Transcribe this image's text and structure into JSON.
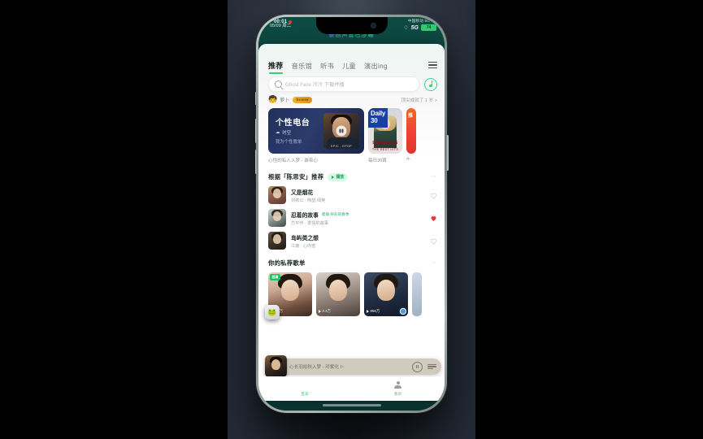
{
  "status_bar": {
    "time": "00:01",
    "date": "05/09 周二",
    "carrier": "中国移动 5G 4G",
    "network": "5G",
    "battery": "74",
    "wifi_icon": "wifi-icon",
    "record_dot": "recording-indicator",
    "notification_banner": "录制声音已涉唰"
  },
  "nav_tabs": [
    {
      "label": "推荐",
      "active": true
    },
    {
      "label": "音乐馆",
      "active": false
    },
    {
      "label": "听书",
      "active": false
    },
    {
      "label": "儿童",
      "active": false
    },
    {
      "label": "演出ing",
      "active": false
    }
  ],
  "header": {
    "menu_icon": "hamburger-menu-icon",
    "note_icon": "music-note-icon"
  },
  "search": {
    "icon": "search-icon",
    "placeholder": "Ghost Face 冷冷 下载并播"
  },
  "chip_row": {
    "emoji": "🧒",
    "text": "萝卜",
    "badge": "Scorer",
    "right_text": "顶尖成就了 1 岁 >"
  },
  "banners": [
    {
      "id": "personal-radio",
      "title": "个性电台",
      "subtitle_1": "时空",
      "subtitle_2": "我为个性歌单",
      "thumb_caption": "EPIC - EPOP",
      "play_icon": "pause-icon",
      "caption": "心性的私人入梦 - 谁带心"
    },
    {
      "id": "daily-30",
      "title_line1": "Daily",
      "title_line2": "30",
      "artist_line1": "LIAN ROSS",
      "artist_line2": "THE BEST HITS",
      "heart_icon": "heart-outline-icon",
      "caption": "每日30首"
    },
    {
      "id": "third-banner",
      "title": "推",
      "caption": "4-"
    }
  ],
  "recommend_section": {
    "title": "根据「陈思安」推荐",
    "play_all": "播放",
    "play_all_icon": "play-triangle-icon",
    "more_icon": "more-dots-icon",
    "songs": [
      {
        "name": "又是烟花",
        "tag": "",
        "artist": "刘欢公 - 陶喆 闻英",
        "liked": false
      },
      {
        "name": "忍着的故事",
        "tag": "蜡角 好彩的春季",
        "artist": "方平作 - 爱情的故事",
        "liked": true
      },
      {
        "name": "岛屿类之想",
        "tag": "",
        "artist": "江南 - 心内密",
        "liked": false
      }
    ]
  },
  "playlist_section": {
    "title": "你的私荐歌单",
    "more_icon": "more-dots-icon",
    "videos": [
      {
        "badge": "超清",
        "count": "1.6万",
        "play_icon": "play-triangle-icon",
        "marked": false
      },
      {
        "badge": "",
        "count": "2.3万",
        "play_icon": "play-triangle-icon",
        "marked": false
      },
      {
        "badge": "",
        "count": "856万",
        "play_icon": "play-triangle-icon",
        "marked": true
      },
      {
        "badge": "",
        "count": "",
        "play_icon": "",
        "marked": false
      }
    ]
  },
  "mini_player": {
    "title": "心长羽拾秋入梦 - 邓紫化 I~",
    "pause_icon": "pause-circle-icon",
    "queue_icon": "playlist-queue-icon",
    "cover": "album-cover"
  },
  "bottom_nav": [
    {
      "label": "音乐",
      "icon": "music-disc-icon",
      "active": true
    },
    {
      "label": "我的",
      "icon": "person-icon",
      "active": false
    }
  ],
  "floating_assistant": {
    "icon": "🐸",
    "name": "floating-assistant-icon"
  }
}
